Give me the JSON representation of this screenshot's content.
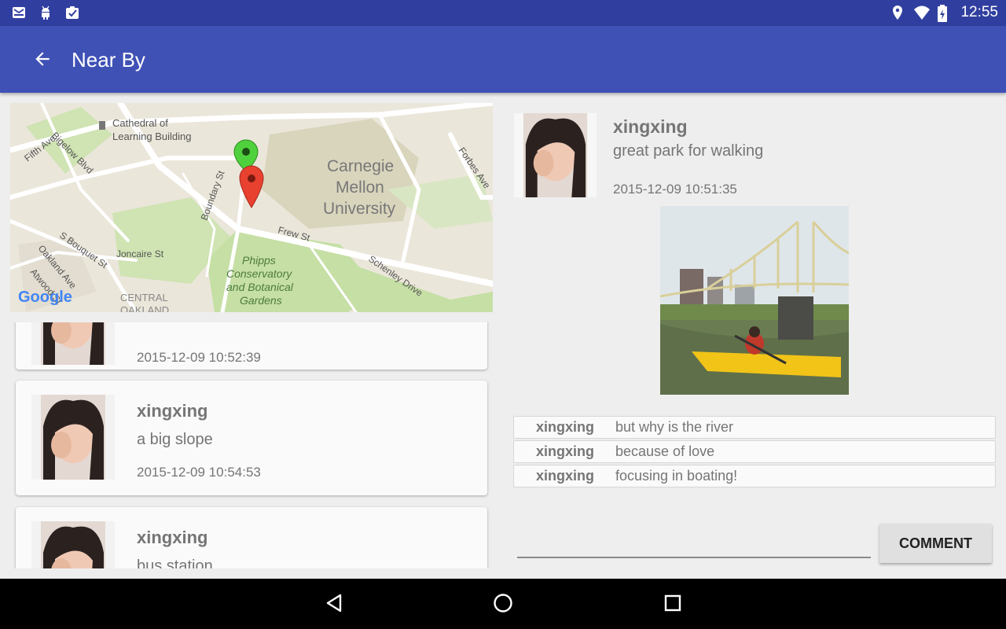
{
  "status_bar": {
    "time": "12:55",
    "left_icons": [
      "mail-icon",
      "android-icon",
      "clipboard-check-icon"
    ],
    "right_icons": [
      "location-icon",
      "wifi-icon",
      "battery-charging-icon"
    ]
  },
  "app_bar": {
    "title": "Near By",
    "back_icon": "arrow-back-icon"
  },
  "map": {
    "labels": {
      "cathedral": "Cathedral of",
      "cathedral2": "Learning Building",
      "cmu1": "Carnegie",
      "cmu2": "Mellon",
      "cmu3": "University",
      "bigelow": "Bigelow Blvd",
      "fifth": "Fifth Ave",
      "boundary": "Boundary St",
      "forbes": "Forbes Ave",
      "frew": "Frew St",
      "bouquet": "S Bouquet St",
      "joncaire": "Joncaire St",
      "oakland": "Oakland Ave",
      "atwood": "Atwood St",
      "phipps1": "Phipps",
      "phipps2": "Conservatory",
      "phipps3": "and Botanical",
      "phipps4": "Gardens",
      "schenley": "Schenley Drive",
      "central1": "CENTRAL",
      "central2": "OAKLAND",
      "google": "Google"
    },
    "markers": [
      "green-marker",
      "red-marker"
    ]
  },
  "posts": [
    {
      "user": "xingxing",
      "text": "",
      "time": "2015-12-09 10:52:39"
    },
    {
      "user": "xingxing",
      "text": "a big slope",
      "time": "2015-12-09 10:54:53"
    },
    {
      "user": "xingxing",
      "text": "bus station",
      "time": ""
    }
  ],
  "detail": {
    "user": "xingxing",
    "text": "great park for walking",
    "time": "2015-12-09 10:51:35"
  },
  "comments": [
    {
      "user": "xingxing",
      "text": "but why is the river"
    },
    {
      "user": "xingxing",
      "text": "because of love"
    },
    {
      "user": "xingxing",
      "text": "focusing in boating!"
    }
  ],
  "comment_input": {
    "value": "",
    "placeholder": ""
  },
  "comment_button": "COMMENT",
  "colors": {
    "status_bar": "#303f9f",
    "app_bar": "#3f51b5",
    "background": "#eeeeee",
    "text_secondary": "#757575"
  },
  "nav_bar": {
    "icons": [
      "back-triangle-icon",
      "home-circle-icon",
      "recents-square-icon"
    ]
  }
}
